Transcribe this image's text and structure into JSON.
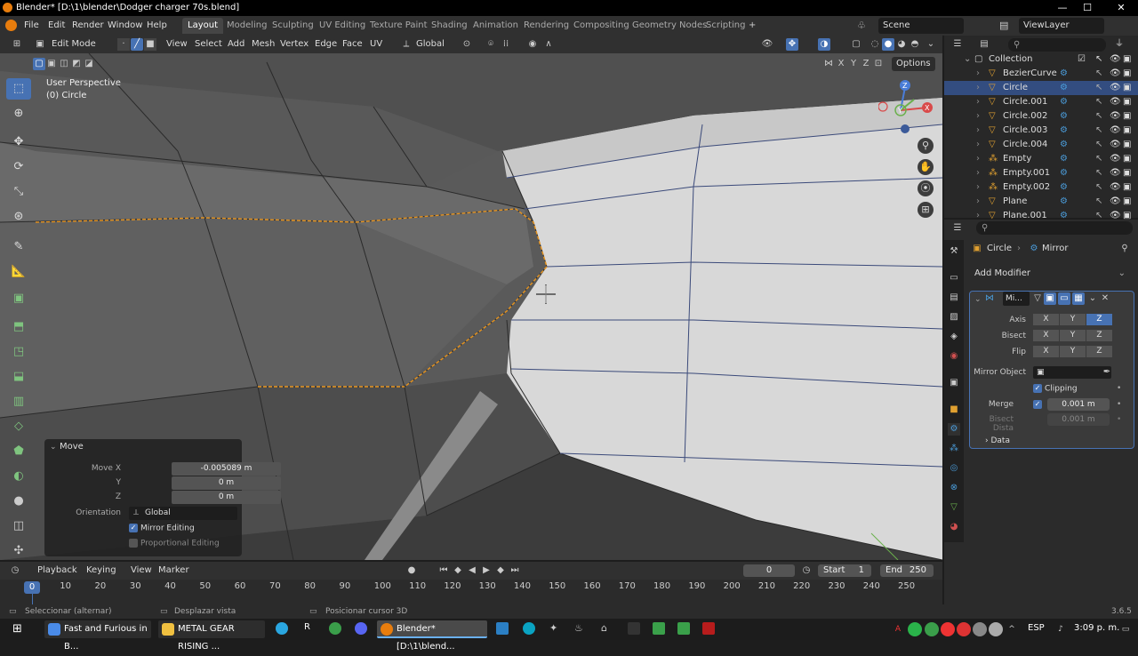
{
  "window": {
    "title": "Blender* [D:\\1\\blender\\Dodger charger 70s.blend]",
    "minimize": "—",
    "maximize": "☐",
    "close": "✕"
  },
  "menubar": {
    "items": [
      "File",
      "Edit",
      "Render",
      "Window",
      "Help"
    ]
  },
  "workspaces": {
    "tabs": [
      "Layout",
      "Modeling",
      "Sculpting",
      "UV Editing",
      "Texture Paint",
      "Shading",
      "Animation",
      "Rendering",
      "Compositing",
      "Geometry Nodes",
      "Scripting"
    ],
    "active": "Layout",
    "add": "+"
  },
  "scene": {
    "label": "Scene",
    "viewlayer": "ViewLayer"
  },
  "header": {
    "mode": "Edit Mode",
    "menus": [
      "View",
      "Select",
      "Add",
      "Mesh",
      "Vertex",
      "Edge",
      "Face",
      "UV"
    ],
    "transform": "Global",
    "xyz": [
      "X",
      "Y",
      "Z"
    ],
    "options": "Options"
  },
  "viewport": {
    "perspective": "User Perspective",
    "object": "(0) Circle"
  },
  "move_panel": {
    "title": "Move",
    "move_x_label": "Move X",
    "move_x": "-0.005089 m",
    "y_label": "Y",
    "y": "0 m",
    "z_label": "Z",
    "z": "0 m",
    "orientation_label": "Orientation",
    "orientation": "Global",
    "mirror_editing": "Mirror Editing",
    "proportional_editing": "Proportional Editing"
  },
  "gizmo": {
    "z": "Z",
    "x": "X",
    "y": "Y"
  },
  "timeline": {
    "menus": [
      "Playback",
      "Keying",
      "View",
      "Marker"
    ],
    "current": "0",
    "start_label": "Start",
    "start": "1",
    "end_label": "End",
    "end": "250",
    "frame": "0",
    "ticks": [
      "10",
      "20",
      "30",
      "40",
      "50",
      "60",
      "70",
      "80",
      "90",
      "100",
      "110",
      "120",
      "130",
      "140",
      "150",
      "160",
      "170",
      "180",
      "190",
      "200",
      "210",
      "220",
      "230",
      "240",
      "250"
    ]
  },
  "status": {
    "select": "Seleccionar (alternar)",
    "pan": "Desplazar vista",
    "cursor": "Posicionar cursor 3D",
    "version": "3.6.5"
  },
  "outliner": {
    "root": "Collection",
    "items": [
      "BezierCurve",
      "Circle",
      "Circle.001",
      "Circle.002",
      "Circle.003",
      "Circle.004",
      "Empty",
      "Empty.001",
      "Empty.002",
      "Plane",
      "Plane.001"
    ],
    "active": "Circle"
  },
  "properties": {
    "object": "Circle",
    "breadcrumb_sep": "›",
    "modifier_tab": "Mirror",
    "add_modifier": "Add Modifier",
    "modifier_name": "Mi...",
    "axis_label": "Axis",
    "bisect_label": "Bisect",
    "flip_label": "Flip",
    "axes": [
      "X",
      "Y",
      "Z"
    ],
    "mirror_object_label": "Mirror Object",
    "clipping": "Clipping",
    "merge_label": "Merge",
    "merge": "0.001 m",
    "bisect_dist_label": "Bisect Dista",
    "bisect_dist": "0.001 m",
    "data_label": "Data"
  },
  "taskbar": {
    "items": [
      "Fast and Furious in B...",
      "METAL GEAR RISING ...",
      "Blender* [D:\\1\\blend..."
    ],
    "lang": "ESP",
    "time": "3:09 p. m."
  },
  "colors": {
    "accent": "#4772b3",
    "active_row": "#334d80",
    "blender_orange": "#e87d0d"
  }
}
